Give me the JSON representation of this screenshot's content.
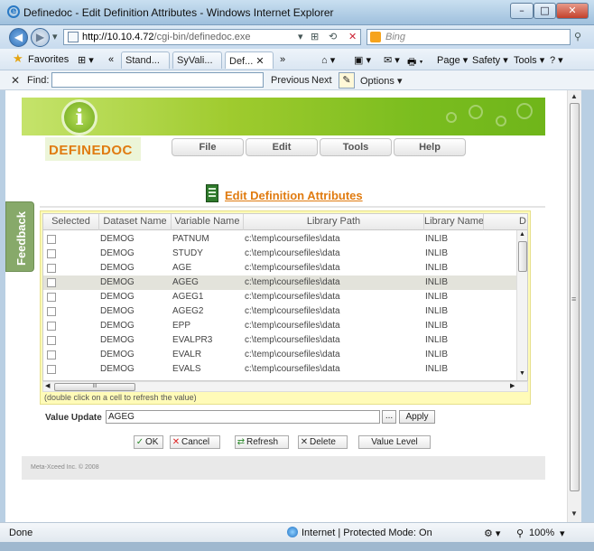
{
  "window": {
    "title": "Definedoc - Edit Definition Attributes - Windows Internet Explorer",
    "minimize": "–",
    "maximize": "□",
    "close": "✕"
  },
  "address": {
    "back": "◀",
    "forward": "▶",
    "url_host": "http://10.10.4.72",
    "url_path": "/cgi-bin/definedoc.exe",
    "search_placeholder": "Bing",
    "icons": {
      "dropdown": "▾",
      "compat": "⊞",
      "refresh": "⟲",
      "stop": "✕",
      "search": "⚲"
    }
  },
  "favorites_bar": {
    "favorites_label": "Favorites",
    "tabs": [
      {
        "label": "Stand..."
      },
      {
        "label": "SyVali..."
      },
      {
        "label": "Def... ✕",
        "active": true
      }
    ],
    "more": "»",
    "back_tabs": "«",
    "quicktabs": "⊞ ▾",
    "commands": [
      "⌂ ▾",
      "▣ ▾",
      "✉ ▾",
      "🖶 ▾",
      "Page ▾",
      "Safety ▾",
      "Tools ▾",
      "? ▾"
    ]
  },
  "findbar": {
    "close": "✕",
    "label": "Find:",
    "value": "",
    "previous": "Previous",
    "next": "Next",
    "options": "Options ▾"
  },
  "app": {
    "logo_glyph": "i",
    "logo_text": "DEFINEDOC",
    "menu": [
      {
        "label": "File"
      },
      {
        "label": "Edit"
      },
      {
        "label": "Tools"
      },
      {
        "label": "Help"
      }
    ],
    "page_heading": "Edit Definition Attributes",
    "feedback_label": "Feedback"
  },
  "grid": {
    "columns": [
      "Selected",
      "Dataset Name",
      "Variable Name",
      "Library Path",
      "Library Name",
      "D"
    ],
    "rows": [
      {
        "dataset": "DEMOG",
        "variable": "PATNUM",
        "path": "c:\\temp\\coursefiles\\data",
        "library": "INLIB",
        "selected": false
      },
      {
        "dataset": "DEMOG",
        "variable": "STUDY",
        "path": "c:\\temp\\coursefiles\\data",
        "library": "INLIB",
        "selected": false
      },
      {
        "dataset": "DEMOG",
        "variable": "AGE",
        "path": "c:\\temp\\coursefiles\\data",
        "library": "INLIB",
        "selected": false
      },
      {
        "dataset": "DEMOG",
        "variable": "AGEG",
        "path": "c:\\temp\\coursefiles\\data",
        "library": "INLIB",
        "selected": true
      },
      {
        "dataset": "DEMOG",
        "variable": "AGEG1",
        "path": "c:\\temp\\coursefiles\\data",
        "library": "INLIB",
        "selected": false
      },
      {
        "dataset": "DEMOG",
        "variable": "AGEG2",
        "path": "c:\\temp\\coursefiles\\data",
        "library": "INLIB",
        "selected": false
      },
      {
        "dataset": "DEMOG",
        "variable": "EPP",
        "path": "c:\\temp\\coursefiles\\data",
        "library": "INLIB",
        "selected": false
      },
      {
        "dataset": "DEMOG",
        "variable": "EVALPR3",
        "path": "c:\\temp\\coursefiles\\data",
        "library": "INLIB",
        "selected": false
      },
      {
        "dataset": "DEMOG",
        "variable": "EVALR",
        "path": "c:\\temp\\coursefiles\\data",
        "library": "INLIB",
        "selected": false
      },
      {
        "dataset": "DEMOG",
        "variable": "EVALS",
        "path": "c:\\temp\\coursefiles\\data",
        "library": "INLIB",
        "selected": false
      }
    ],
    "hscroll_thumb": "III",
    "hint": "(double click on a cell to refresh the value)"
  },
  "value_update": {
    "label": "Value Update",
    "value": "AGEG",
    "browse": "...",
    "apply": "Apply"
  },
  "actions": {
    "ok": "OK",
    "cancel": "Cancel",
    "refresh": "Refresh",
    "delete": "Delete",
    "value_level": "Value Level"
  },
  "footer": {
    "copyright": "Meta-Xceed Inc. ©  2008"
  },
  "status": {
    "left": "Done",
    "zone": "Internet | Protected Mode: On",
    "zoom": "100%"
  },
  "colors": {
    "accent_orange": "#e07b10",
    "banner_green": "#7bbd1f",
    "grid_frame_yellow": "#fffbb8",
    "feedback_green": "#87a96a"
  }
}
